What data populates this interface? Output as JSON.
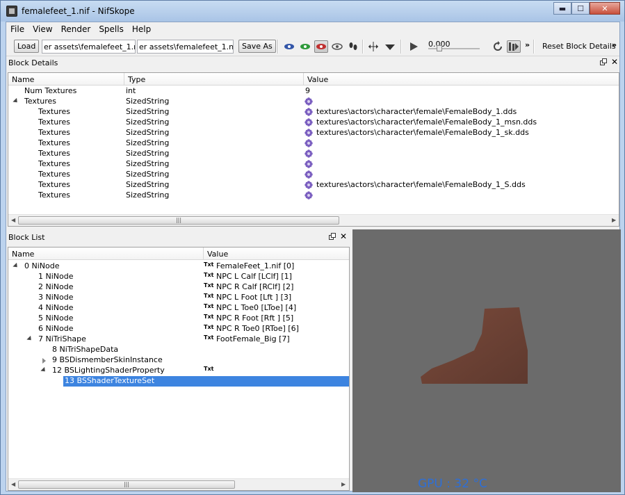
{
  "window": {
    "title": "femalefeet_1.nif - NifSkope",
    "min": "▬",
    "max": "☐",
    "close": "✕"
  },
  "menu": [
    "File",
    "View",
    "Render",
    "Spells",
    "Help"
  ],
  "toolbar": {
    "load_label": "Load",
    "load_path": "er assets\\femalefeet_1.nif",
    "save_path": "er assets\\femalefeet_1.nif",
    "save_as_label": "Save As",
    "time_value": "0.000",
    "reset_label": "Reset Block Details",
    "overflow": "»"
  },
  "block_details": {
    "title": "Block Details",
    "columns": [
      "Name",
      "Type",
      "Value"
    ],
    "rows": [
      {
        "name": "Num Textures",
        "type": "int",
        "value": "9",
        "indent": 1,
        "expander": false,
        "icon": false
      },
      {
        "name": "Textures",
        "type": "SizedString",
        "value": "",
        "indent": 1,
        "expander": true,
        "icon": true
      },
      {
        "name": "Textures",
        "type": "SizedString",
        "value": "textures\\actors\\character\\female\\FemaleBody_1.dds",
        "indent": 2,
        "expander": false,
        "icon": true
      },
      {
        "name": "Textures",
        "type": "SizedString",
        "value": "textures\\actors\\character\\female\\FemaleBody_1_msn.dds",
        "indent": 2,
        "expander": false,
        "icon": true
      },
      {
        "name": "Textures",
        "type": "SizedString",
        "value": "textures\\actors\\character\\female\\FemaleBody_1_sk.dds",
        "indent": 2,
        "expander": false,
        "icon": true
      },
      {
        "name": "Textures",
        "type": "SizedString",
        "value": "",
        "indent": 2,
        "expander": false,
        "icon": true
      },
      {
        "name": "Textures",
        "type": "SizedString",
        "value": "",
        "indent": 2,
        "expander": false,
        "icon": true
      },
      {
        "name": "Textures",
        "type": "SizedString",
        "value": "",
        "indent": 2,
        "expander": false,
        "icon": true
      },
      {
        "name": "Textures",
        "type": "SizedString",
        "value": "",
        "indent": 2,
        "expander": false,
        "icon": true
      },
      {
        "name": "Textures",
        "type": "SizedString",
        "value": "textures\\actors\\character\\female\\FemaleBody_1_S.dds",
        "indent": 2,
        "expander": false,
        "icon": true
      },
      {
        "name": "Textures",
        "type": "SizedString",
        "value": "",
        "indent": 2,
        "expander": false,
        "icon": true
      }
    ]
  },
  "block_list": {
    "title": "Block List",
    "columns": [
      "Name",
      "Value"
    ],
    "rows": [
      {
        "name": "0 NiNode",
        "value": "FemaleFeet_1.nif [0]",
        "level": 0,
        "expander": "down",
        "txt": true
      },
      {
        "name": "1 NiNode",
        "value": "NPC L Calf [LClf] [1]",
        "level": 1,
        "expander": "",
        "txt": true
      },
      {
        "name": "2 NiNode",
        "value": "NPC R Calf [RClf] [2]",
        "level": 1,
        "expander": "",
        "txt": true
      },
      {
        "name": "3 NiNode",
        "value": "NPC L Foot [Lft ] [3]",
        "level": 1,
        "expander": "",
        "txt": true
      },
      {
        "name": "4 NiNode",
        "value": "NPC L Toe0 [LToe] [4]",
        "level": 1,
        "expander": "",
        "txt": true
      },
      {
        "name": "5 NiNode",
        "value": "NPC R Foot [Rft ] [5]",
        "level": 1,
        "expander": "",
        "txt": true
      },
      {
        "name": "6 NiNode",
        "value": "NPC R Toe0 [RToe] [6]",
        "level": 1,
        "expander": "",
        "txt": true
      },
      {
        "name": "7 NiTriShape",
        "value": "FootFemale_Big [7]",
        "level": 1,
        "expander": "down",
        "txt": true
      },
      {
        "name": "8 NiTriShapeData",
        "value": "",
        "level": 2,
        "expander": "",
        "txt": false
      },
      {
        "name": "9 BSDismemberSkinInstance",
        "value": "",
        "level": 2,
        "expander": "right",
        "txt": false
      },
      {
        "name": "12 BSLightingShaderProperty",
        "value": "",
        "level": 2,
        "expander": "down",
        "txt": true
      },
      {
        "name": "13 BSShaderTextureSet",
        "value": "",
        "level": 3,
        "expander": "",
        "txt": false,
        "selected": true
      }
    ],
    "txt_icon": "Txt"
  },
  "viewport": {
    "gpu_label": "GPU : 32 °C",
    "mesh_color": "#6b4033",
    "background": "#6b6b6b"
  },
  "colors": {
    "selection": "#3d84e0",
    "titlebar": "#bcd3ee"
  }
}
